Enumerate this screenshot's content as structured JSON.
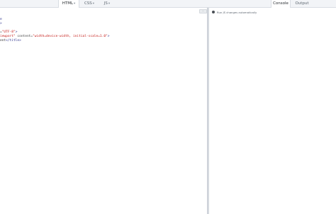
{
  "tabs": {
    "html": {
      "label": "HTML",
      "caret": "▾"
    },
    "css": {
      "label": "CSS",
      "caret": "▾"
    },
    "js": {
      "label": "JS",
      "caret": "▾"
    },
    "console": {
      "label": "Console"
    },
    "output": {
      "label": "Output"
    }
  },
  "editor": {
    "toggle_label": "···",
    "lines": [
      {
        "parts": [
          {
            "c": "tag",
            "t": "e"
          }
        ]
      },
      {
        "parts": [
          {
            "c": "tag",
            "t": ">"
          }
        ]
      },
      {
        "parts": [
          {
            "c": "txt",
            "t": ""
          }
        ]
      },
      {
        "parts": [
          {
            "c": "attr",
            "t": "="
          },
          {
            "c": "str",
            "t": "\"UTF-8\""
          },
          {
            "c": "tag",
            "t": ">"
          }
        ]
      },
      {
        "parts": [
          {
            "c": "str",
            "t": "iewport\""
          },
          {
            "c": "attr",
            "t": " content="
          },
          {
            "c": "str",
            "t": "\"width=device-width, initial-scale=1.0\""
          },
          {
            "c": "tag",
            "t": ">"
          }
        ]
      },
      {
        "parts": [
          {
            "c": "txt",
            "t": "ent"
          },
          {
            "c": "tag",
            "t": "</title>"
          }
        ]
      }
    ]
  },
  "console": {
    "run_label": "Run JS changes automatically",
    "checked": true
  }
}
